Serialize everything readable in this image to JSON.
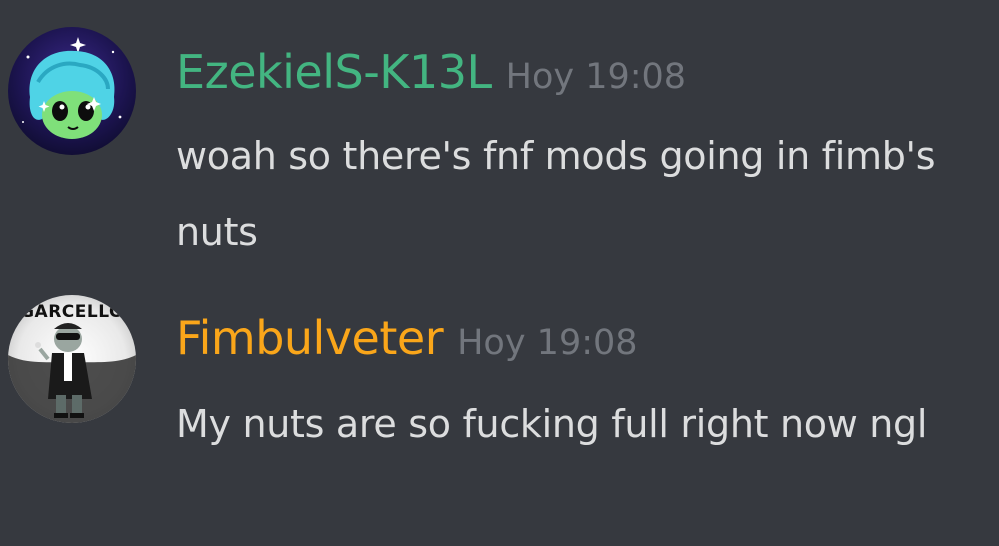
{
  "messages": [
    {
      "author": "EzekielS-K13L",
      "author_color": "#43b581",
      "timestamp": "Hoy 19:08",
      "text": "woah so there's fnf mods going in fimb's nuts"
    },
    {
      "author": "Fimbulveter",
      "author_color": "#faa61a",
      "timestamp": "Hoy 19:08",
      "text": "My nuts are so fucking full right now ngl",
      "avatar_text": "GARCELLO"
    }
  ]
}
